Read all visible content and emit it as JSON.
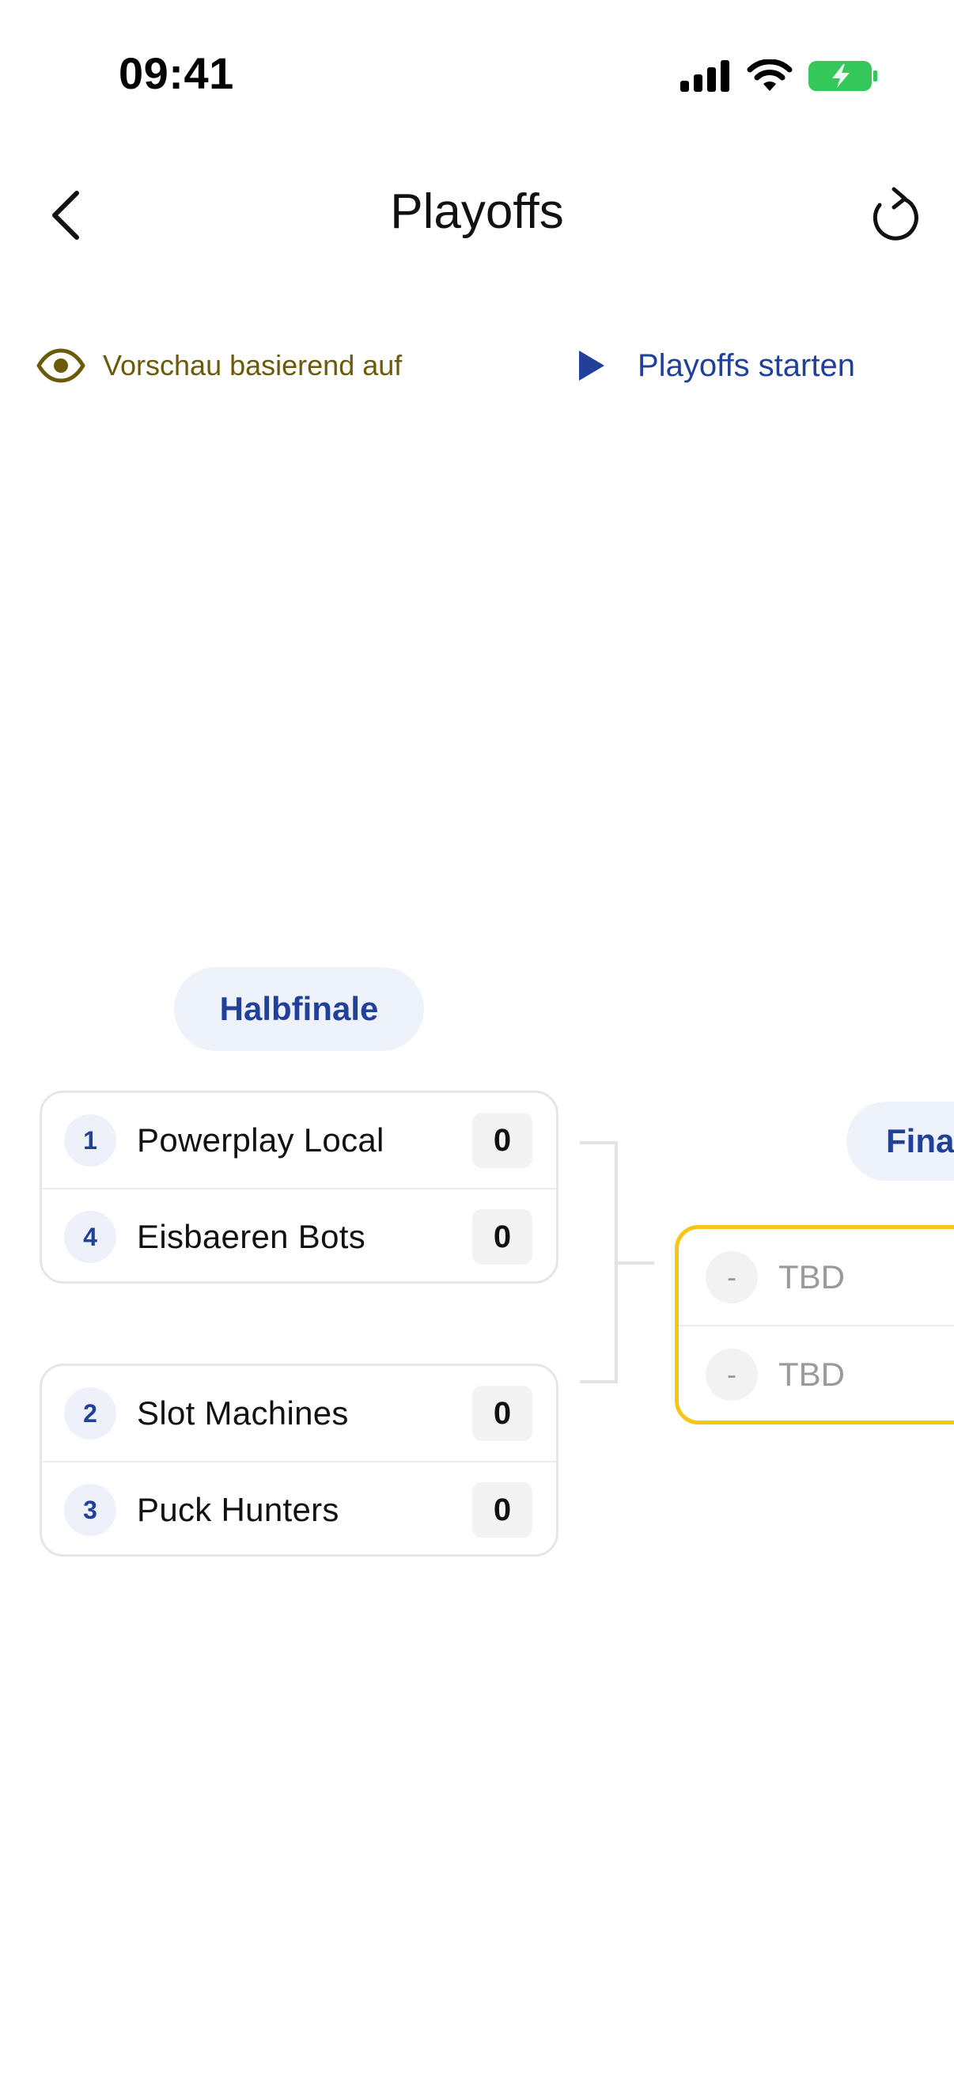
{
  "status_bar": {
    "time": "09:41"
  },
  "nav": {
    "title": "Playoffs",
    "back_icon": "chevron-left-icon",
    "refresh_icon": "refresh-icon"
  },
  "info": {
    "preview_text": "Vorschau basierend auf",
    "preview_icon": "eye-icon",
    "start_label": "Playoffs starten",
    "start_icon": "play-icon"
  },
  "bracket": {
    "semifinal_label": "Halbfinale",
    "final_label": "Fina",
    "semifinals": [
      {
        "teams": [
          {
            "seed": "1",
            "name": "Powerplay Local",
            "score": "0"
          },
          {
            "seed": "4",
            "name": "Eisbaeren Bots",
            "score": "0"
          }
        ]
      },
      {
        "teams": [
          {
            "seed": "2",
            "name": "Slot Machines",
            "score": "0"
          },
          {
            "seed": "3",
            "name": "Puck Hunters",
            "score": "0"
          }
        ]
      }
    ],
    "final": {
      "teams": [
        {
          "seed": "-",
          "name": "TBD"
        },
        {
          "seed": "-",
          "name": "TBD"
        }
      ]
    }
  },
  "colors": {
    "accent": "#21409a",
    "preview_text": "#6b5a0a",
    "final_border": "#f5c518",
    "chip_bg": "#eef2fb",
    "battery": "#34c759"
  }
}
